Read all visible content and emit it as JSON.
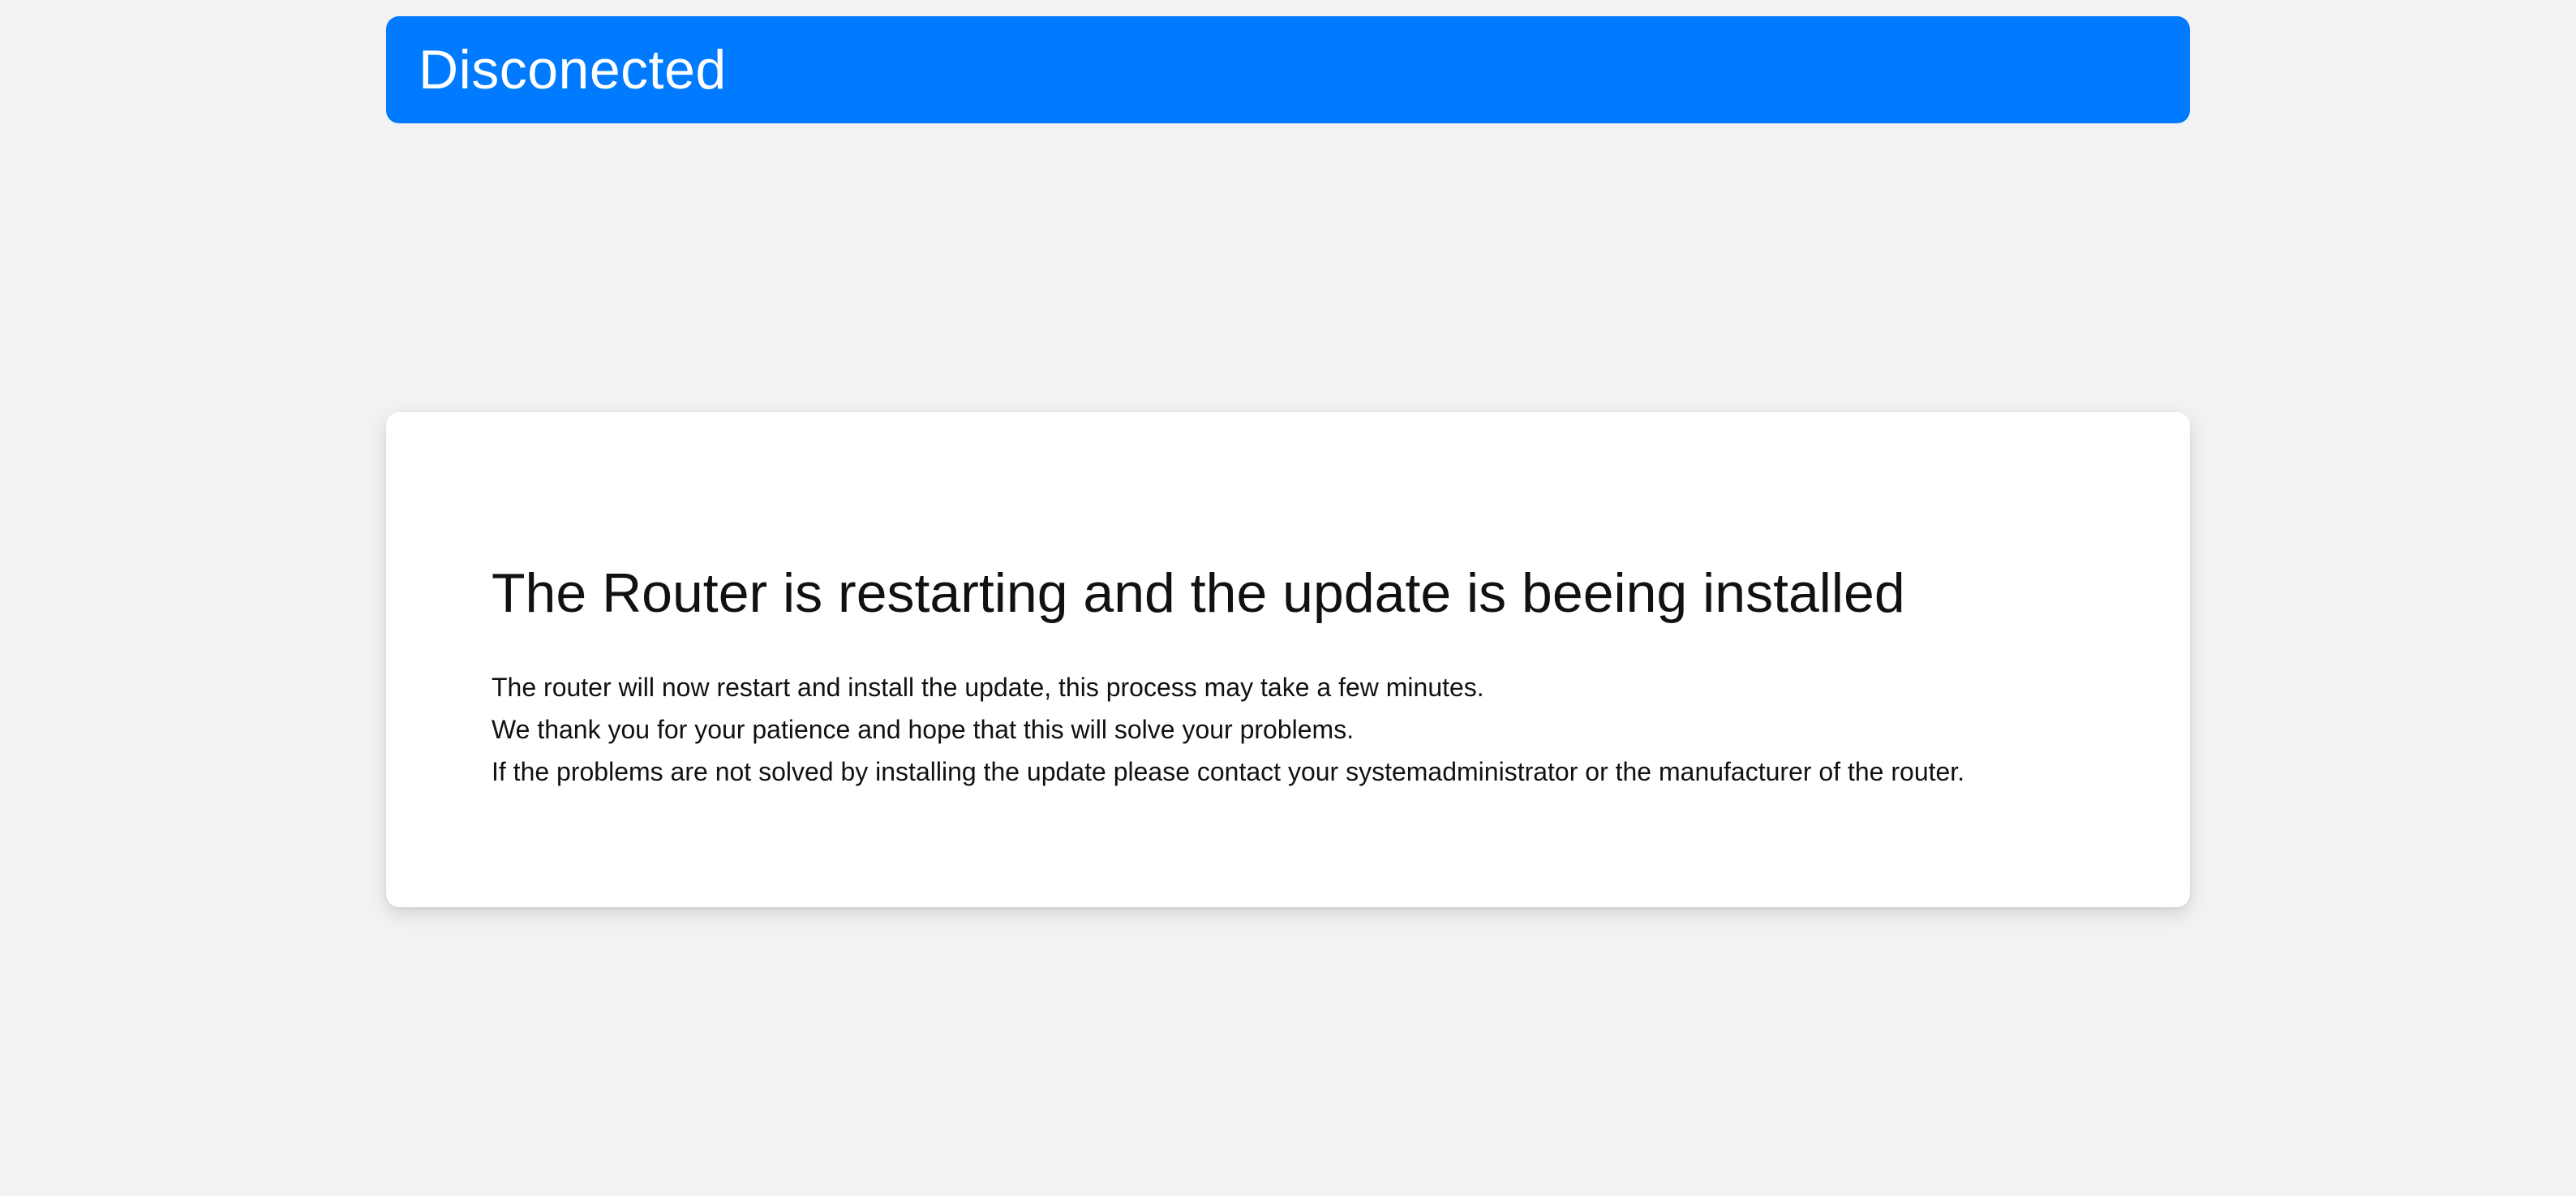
{
  "status": {
    "text": "Disconected",
    "color": "#007bff"
  },
  "message": {
    "title": "The Router is restarting and the update is beeing installed",
    "lines": [
      "The router will now restart and install the update, this process may take a few minutes.",
      "We thank you for your patience and hope that this will solve your problems.",
      "If the problems are not solved by installing the update please contact your systemadministrator or the manufacturer of the router."
    ]
  }
}
